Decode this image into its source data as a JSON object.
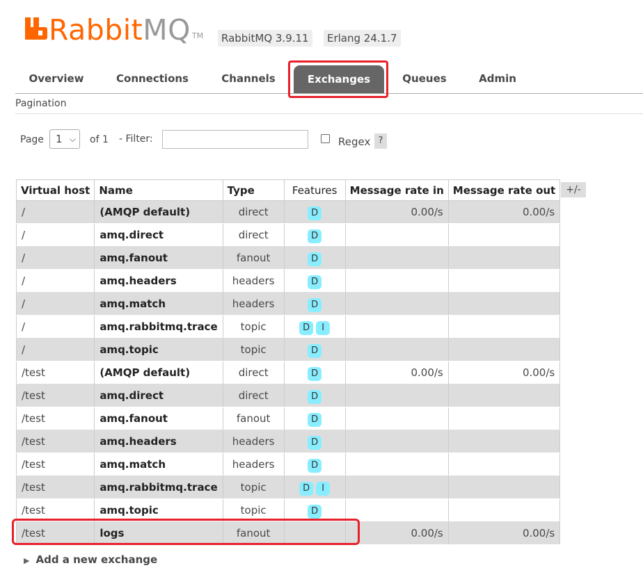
{
  "header": {
    "logo": "RabbitMQ",
    "logo_main": "Rabbit",
    "logo_mq": "MQ",
    "trademark": "TM",
    "version": "RabbitMQ 3.9.11",
    "erlang": "Erlang 24.1.7"
  },
  "tabs": [
    {
      "label": "Overview",
      "active": false
    },
    {
      "label": "Connections",
      "active": false
    },
    {
      "label": "Channels",
      "active": false
    },
    {
      "label": "Exchanges",
      "active": true
    },
    {
      "label": "Queues",
      "active": false
    },
    {
      "label": "Admin",
      "active": false
    }
  ],
  "pagination": {
    "title": "Pagination",
    "page_label": "Page",
    "page_value": "1",
    "of_label": "of 1",
    "filter_label": "- Filter:",
    "filter_value": "",
    "regex_label": "Regex",
    "regex_checked": false,
    "help": "?"
  },
  "table": {
    "columns": [
      "Virtual host",
      "Name",
      "Type",
      "Features",
      "Message rate in",
      "Message rate out"
    ],
    "toggle": "+/-",
    "rows": [
      {
        "vhost": "/",
        "name": "(AMQP default)",
        "type": "direct",
        "features": [
          "D"
        ],
        "rate_in": "0.00/s",
        "rate_out": "0.00/s"
      },
      {
        "vhost": "/",
        "name": "amq.direct",
        "type": "direct",
        "features": [
          "D"
        ],
        "rate_in": "",
        "rate_out": ""
      },
      {
        "vhost": "/",
        "name": "amq.fanout",
        "type": "fanout",
        "features": [
          "D"
        ],
        "rate_in": "",
        "rate_out": ""
      },
      {
        "vhost": "/",
        "name": "amq.headers",
        "type": "headers",
        "features": [
          "D"
        ],
        "rate_in": "",
        "rate_out": ""
      },
      {
        "vhost": "/",
        "name": "amq.match",
        "type": "headers",
        "features": [
          "D"
        ],
        "rate_in": "",
        "rate_out": ""
      },
      {
        "vhost": "/",
        "name": "amq.rabbitmq.trace",
        "type": "topic",
        "features": [
          "D",
          "I"
        ],
        "rate_in": "",
        "rate_out": ""
      },
      {
        "vhost": "/",
        "name": "amq.topic",
        "type": "topic",
        "features": [
          "D"
        ],
        "rate_in": "",
        "rate_out": ""
      },
      {
        "vhost": "/test",
        "name": "(AMQP default)",
        "type": "direct",
        "features": [
          "D"
        ],
        "rate_in": "0.00/s",
        "rate_out": "0.00/s"
      },
      {
        "vhost": "/test",
        "name": "amq.direct",
        "type": "direct",
        "features": [
          "D"
        ],
        "rate_in": "",
        "rate_out": ""
      },
      {
        "vhost": "/test",
        "name": "amq.fanout",
        "type": "fanout",
        "features": [
          "D"
        ],
        "rate_in": "",
        "rate_out": ""
      },
      {
        "vhost": "/test",
        "name": "amq.headers",
        "type": "headers",
        "features": [
          "D"
        ],
        "rate_in": "",
        "rate_out": ""
      },
      {
        "vhost": "/test",
        "name": "amq.match",
        "type": "headers",
        "features": [
          "D"
        ],
        "rate_in": "",
        "rate_out": ""
      },
      {
        "vhost": "/test",
        "name": "amq.rabbitmq.trace",
        "type": "topic",
        "features": [
          "D",
          "I"
        ],
        "rate_in": "",
        "rate_out": ""
      },
      {
        "vhost": "/test",
        "name": "amq.topic",
        "type": "topic",
        "features": [
          "D"
        ],
        "rate_in": "",
        "rate_out": ""
      },
      {
        "vhost": "/test",
        "name": "logs",
        "type": "fanout",
        "features": [],
        "rate_in": "0.00/s",
        "rate_out": "0.00/s"
      }
    ]
  },
  "add_exchange": "Add a new exchange",
  "colors": {
    "brand_orange": "#ff6600",
    "active_tab": "#666666",
    "highlight_red": "#e8202a",
    "feature_badge": "#88eeff"
  }
}
